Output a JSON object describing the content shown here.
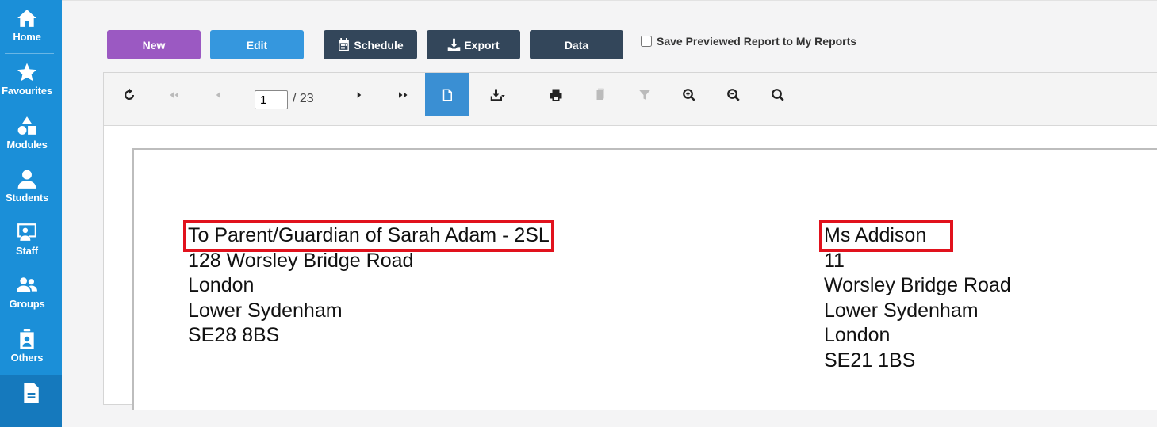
{
  "sidebar": {
    "items": [
      {
        "label": "Home",
        "icon": "home-icon"
      },
      {
        "label": "Favourites",
        "icon": "star-icon"
      },
      {
        "label": "Modules",
        "icon": "shapes-icon"
      },
      {
        "label": "Students",
        "icon": "user-icon"
      },
      {
        "label": "Staff",
        "icon": "teacher-board-icon"
      },
      {
        "label": "Groups",
        "icon": "group-icon"
      },
      {
        "label": "Others",
        "icon": "badge-icon"
      },
      {
        "label": "",
        "icon": "document-icon"
      }
    ]
  },
  "actions": {
    "new_label": "New",
    "edit_label": "Edit",
    "schedule_label": "Schedule",
    "export_label": "Export",
    "data_label": "Data",
    "save_preview_label": "Save Previewed Report to My Reports"
  },
  "viewer": {
    "current_page": "1",
    "total_pages": "/ 23"
  },
  "report": {
    "left_address": {
      "line1": "To Parent/Guardian of Sarah Adam - 2SL",
      "line2": "128 Worsley Bridge Road",
      "line3": "London",
      "line4": "Lower Sydenham",
      "line5": "SE28 8BS"
    },
    "right_address": {
      "line1": "Ms Addison",
      "line2": "11",
      "line3": "Worsley Bridge Road",
      "line4": "Lower Sydenham",
      "line5": "London",
      "line6": "SE21 1BS"
    }
  },
  "colors": {
    "sidebar": "#1b8fd8",
    "new_button": "#9b59c2",
    "edit_button": "#3597de",
    "dark_button": "#33465a",
    "highlight_box": "#e1121d"
  }
}
